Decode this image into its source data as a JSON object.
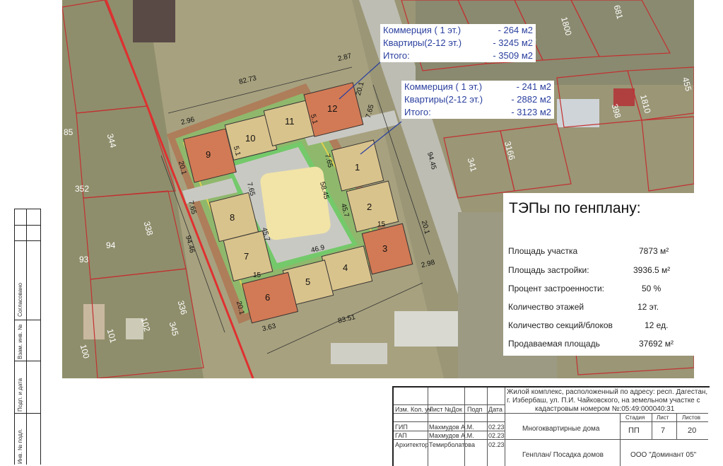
{
  "callout_top": {
    "commerce": "Коммерция ( 1 эт.)",
    "commerce_val": "- 264 м2",
    "flats": "Квартиры(2-12 эт.)",
    "flats_val": "-  3245 м2",
    "total": "Итого:",
    "total_val": "- 3509 м2"
  },
  "callout_mid": {
    "commerce": "Коммерция ( 1 эт.)",
    "commerce_val": "- 241 м2",
    "flats": "Квартиры(2-12 эт.)",
    "flats_val": "-  2882 м2",
    "total": "Итого:",
    "total_val": "- 3123 м2"
  },
  "blocks": [
    "1",
    "2",
    "3",
    "4",
    "5",
    "6",
    "7",
    "8",
    "9",
    "10",
    "11",
    "12"
  ],
  "dims": {
    "top_total": "82.73",
    "bottom_total": "83.51",
    "right_total": "94.45",
    "left_total": "94.46",
    "inner_vert": "58.45",
    "inner_bottom": "46.9",
    "inner_left": "45.7",
    "inner_right": "45.7",
    "d287": "2.87",
    "d296": "2.96",
    "d298": "2.98",
    "d363": "3.63",
    "d765": "7.65",
    "d201": "20.1",
    "d20": "20",
    "d18": "18",
    "d03": "0.3",
    "d15": "15",
    "d51": "5.1",
    "d3": "3"
  },
  "parcels": [
    "1798",
    "1800",
    "681",
    "1810",
    "455",
    "398",
    "341",
    "3166",
    "344",
    "352",
    "338",
    "94",
    "93",
    "101",
    "102",
    "336",
    "345",
    "100",
    "85"
  ],
  "tep": {
    "title": "ТЭПы по генплану:",
    "rows": [
      {
        "label": "Площадь участка",
        "value": "7873 м²"
      },
      {
        "label": "Площадь застройки:",
        "value": "3936.5  м²"
      },
      {
        "label": "Процент застроенности:",
        "value": "50 %"
      },
      {
        "label": "Количество этажей",
        "value": "12 эт."
      },
      {
        "label": "Количество секций/блоков",
        "value": "12 ед."
      },
      {
        "label": "Продаваемая площадь",
        "value": "37692 м²"
      }
    ]
  },
  "side_labels": [
    "Согласовано",
    "Взам. инв. №",
    "Подп. и дата",
    "Инв. № подл."
  ],
  "stamp": {
    "address": "Жилой комплекс, расположенный по адресу: респ. Дагестан,",
    "address2": "г. Избербаш, ул. П.И. Чайковского, на земельном участке  с",
    "address3": "кадастровым номером №:05:49:000040:31",
    "cols": [
      "Изм.",
      "Кол. уч",
      "Лист",
      "№Док",
      "Подп",
      "Дата"
    ],
    "roles": [
      "ГИП",
      "ГАП",
      "Архитектор"
    ],
    "names": [
      "Махмудов А.М.",
      "Махмудов А.М.",
      "Темирболатова"
    ],
    "dates": [
      "02.23",
      "02.23",
      "02.23"
    ],
    "object": "Многоквартирные дома",
    "sheet_title": "Генплан/ Посадка домов",
    "company": "ООО \"Доминант 05\"",
    "stage_h": "Стадия",
    "sheet_h": "Лист",
    "sheets_h": "Листов",
    "stage": "ПП",
    "sheet": "7",
    "sheets": "20"
  }
}
